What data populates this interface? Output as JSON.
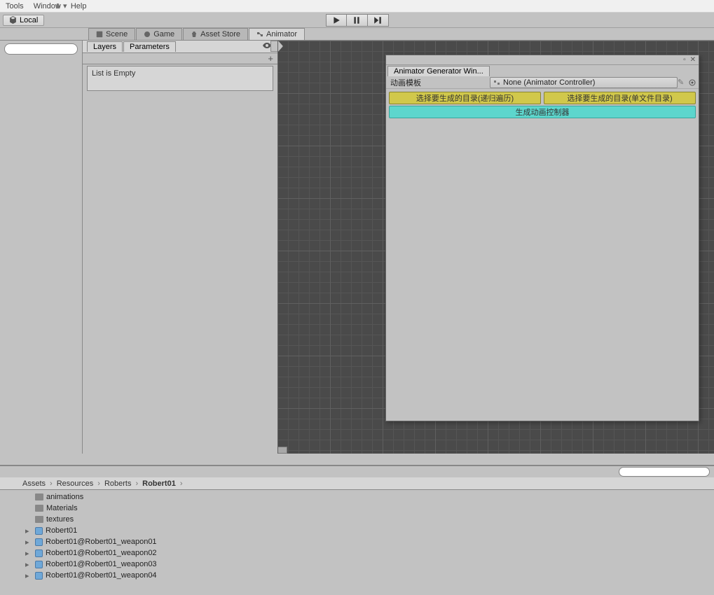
{
  "menu": {
    "tools": "Tools",
    "window": "Window",
    "help": "Help"
  },
  "toolbar": {
    "local": "Local"
  },
  "tabs": {
    "scene": "Scene",
    "game": "Game",
    "asset_store": "Asset Store",
    "animator": "Animator"
  },
  "layers": {
    "tab_layers": "Layers",
    "tab_parameters": "Parameters",
    "empty_text": "List is Empty"
  },
  "float": {
    "title": "Animator Generator Win...",
    "field_label": "动画模板",
    "field_value": "None (Animator Controller)",
    "btn_recursive": "选择要生成的目录(递归遍历)",
    "btn_single": "选择要生成的目录(单文件目录)",
    "btn_generate": "生成动画控制器"
  },
  "breadcrumb": [
    "Assets",
    "Resources",
    "Roberts",
    "Robert01"
  ],
  "project": {
    "folders": [
      "animations",
      "Materials",
      "textures"
    ],
    "prefabs": [
      "Robert01",
      "Robert01@Robert01_weapon01",
      "Robert01@Robert01_weapon02",
      "Robert01@Robert01_weapon03",
      "Robert01@Robert01_weapon04"
    ]
  }
}
